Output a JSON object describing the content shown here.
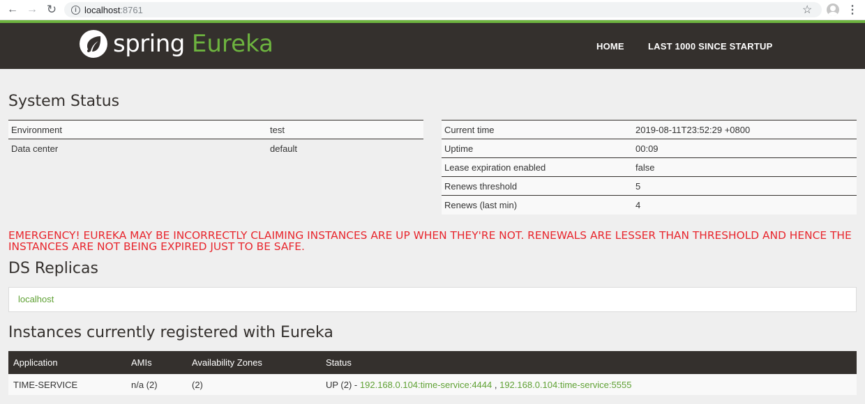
{
  "browser": {
    "url_host": "localhost",
    "url_port": ":8761",
    "back": "←",
    "forward": "→",
    "reload": "↻",
    "star": "☆",
    "menu": "⋮"
  },
  "header": {
    "logo_spring": "spring",
    "logo_eureka": "Eureka",
    "nav": [
      {
        "label": "HOME"
      },
      {
        "label": "LAST 1000 SINCE STARTUP"
      }
    ]
  },
  "system_status": {
    "title": "System Status",
    "left": [
      {
        "key": "Environment",
        "value": "test"
      },
      {
        "key": "Data center",
        "value": "default"
      }
    ],
    "right": [
      {
        "key": "Current time",
        "value": "2019-08-11T23:52:29 +0800"
      },
      {
        "key": "Uptime",
        "value": "00:09"
      },
      {
        "key": "Lease expiration enabled",
        "value": "false"
      },
      {
        "key": "Renews threshold",
        "value": "5"
      },
      {
        "key": "Renews (last min)",
        "value": "4"
      }
    ]
  },
  "emergency": "EMERGENCY! EUREKA MAY BE INCORRECTLY CLAIMING INSTANCES ARE UP WHEN THEY'RE NOT. RENEWALS ARE LESSER THAN THRESHOLD AND HENCE THE INSTANCES ARE NOT BEING EXPIRED JUST TO BE SAFE.",
  "ds_replicas": {
    "title": "DS Replicas",
    "items": [
      "localhost"
    ]
  },
  "instances": {
    "title": "Instances currently registered with Eureka",
    "columns": [
      "Application",
      "AMIs",
      "Availability Zones",
      "Status"
    ],
    "rows": [
      {
        "application": "TIME-SERVICE",
        "amis": "n/a (2)",
        "zones": "(2)",
        "status_prefix": "UP (2) - ",
        "link1": "192.168.0.104:time-service:4444",
        "separator": " , ",
        "link2": "192.168.0.104:time-service:5555"
      }
    ]
  },
  "colors": {
    "brand_green": "#6db33f",
    "header_dark": "#34302d",
    "emergency_red": "#e8262d"
  }
}
